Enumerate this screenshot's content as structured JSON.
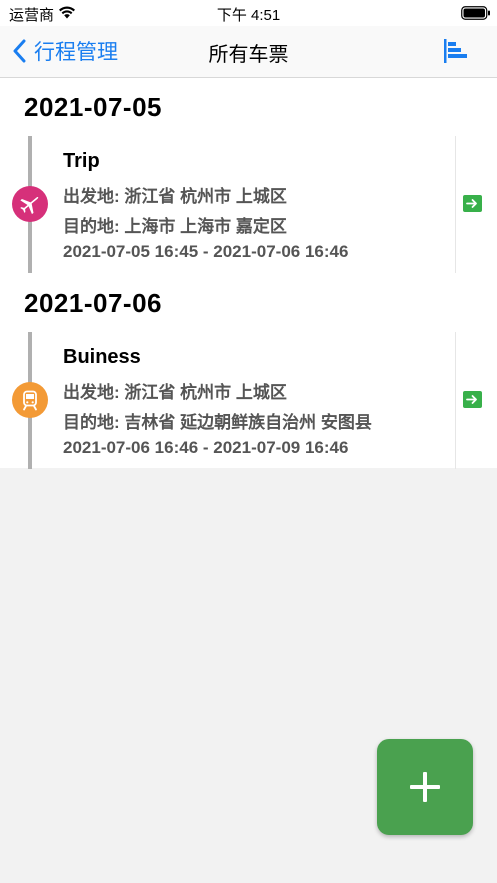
{
  "status_bar": {
    "carrier": "运营商",
    "time": "下午 4:51",
    "wifi_icon": "wifi-icon",
    "battery_icon": "battery-icon"
  },
  "nav": {
    "back_label": "行程管理",
    "title": "所有车票",
    "back_icon": "chevron-left-icon",
    "sort_icon": "bar-chart-icon",
    "accent_color": "#1a7ef0"
  },
  "sections": [
    {
      "date": "2021-07-05",
      "tickets": [
        {
          "name": "Trip",
          "type_icon": "airplane-icon",
          "badge_color": "#d6307a",
          "departure": "出发地: 浙江省 杭州市 上城区",
          "destination": "目的地: 上海市 上海市 嘉定区",
          "time_range": "2021-07-05 16:45 - 2021-07-06 16:46",
          "detail_icon": "arrow-right-box-icon"
        }
      ]
    },
    {
      "date": "2021-07-06",
      "tickets": [
        {
          "name": "Buiness",
          "type_icon": "train-icon",
          "badge_color": "#f39a36",
          "departure": "出发地: 浙江省 杭州市 上城区",
          "destination": "目的地: 吉林省 延边朝鲜族自治州 安图县",
          "time_range": "2021-07-06 16:46 - 2021-07-09 16:46",
          "detail_icon": "arrow-right-box-icon"
        }
      ]
    }
  ],
  "fab": {
    "icon": "plus-icon",
    "color": "#4aa14f"
  }
}
